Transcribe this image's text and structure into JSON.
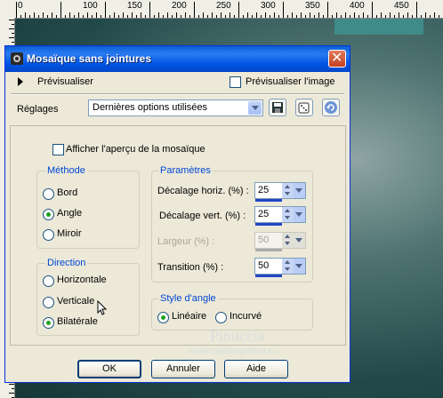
{
  "ruler": {
    "marks": [
      "0",
      "100",
      "150",
      "200",
      "250",
      "300",
      "350",
      "400",
      "450"
    ]
  },
  "dialog": {
    "title": "Mosaïque sans jointures",
    "close_label": "✕",
    "preview_label": "Prévisualiser",
    "preview_image_label": "Prévisualiser l'image",
    "preview_image_checked": false,
    "settings_label": "Réglages",
    "settings_value": "Dernières options utilisées",
    "show_preview_label": "Afficher l'aperçu de la mosaïque",
    "show_preview_checked": false,
    "method": {
      "title": "Méthode",
      "options": [
        "Bord",
        "Angle",
        "Miroir"
      ],
      "selected": "Angle"
    },
    "direction": {
      "title": "Direction",
      "options": [
        "Horizontale",
        "Verticale",
        "Bilatérale"
      ],
      "selected": "Bilatérale"
    },
    "params": {
      "title": "Paramètres",
      "h_offset_label": "Décalage horiz. (%) :",
      "h_offset_value": "25",
      "v_offset_label": "Décalage vert. (%) :",
      "v_offset_value": "25",
      "width_label": "Largeur (%) :",
      "width_value": "50",
      "transition_label": "Transition (%) :",
      "transition_value": "50"
    },
    "angle_style": {
      "title": "Style d'angle",
      "options": [
        "Linéaire",
        "Incurvé"
      ],
      "selected": "Linéaire"
    },
    "buttons": {
      "ok": "OK",
      "cancel": "Annuler",
      "help": "Aide"
    }
  },
  "watermark": {
    "name": "Pinuccia",
    "site": "www.maidiregrafica.eu"
  }
}
